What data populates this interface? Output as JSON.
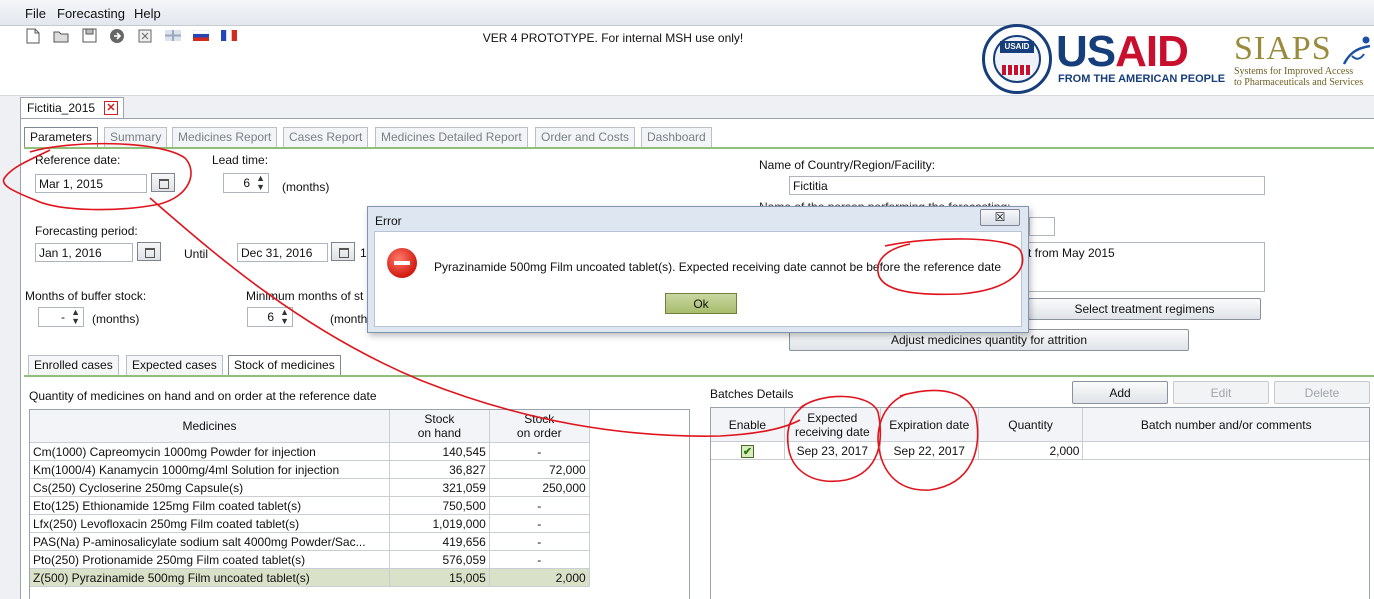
{
  "menu": [
    "File",
    "Forecasting",
    "Help"
  ],
  "toolbar": {
    "icons": [
      "new-document-icon",
      "open-folder-icon",
      "save-icon",
      "go-arrow-icon",
      "export-icon",
      "flag-uk-icon",
      "flag-russia-icon",
      "flag-france-icon"
    ],
    "notice": "VER 4 PROTOTYPE. For internal MSH use only!"
  },
  "logo": {
    "usaid_us": "US",
    "usaid_aid": "AID",
    "usaid_sub": "FROM THE AMERICAN PEOPLE",
    "seal_tag": "USAID",
    "siaps": "SIAPS",
    "siaps_sub1": "Systems for Improved Access",
    "siaps_sub2": "to Pharmaceuticals and Services"
  },
  "document_tab": {
    "label": "Fictitia_2015",
    "close": "✕"
  },
  "tabs": [
    "Parameters",
    "Summary",
    "Medicines Report",
    "Cases Report",
    "Medicines Detailed Report",
    "Order and Costs",
    "Dashboard"
  ],
  "params": {
    "reference_date_label": "Reference date:",
    "reference_date": "Mar 1, 2015",
    "lead_time_label": "Lead time:",
    "lead_time": "6",
    "months_unit": "(months)",
    "months_unit_cut": "(month",
    "forecasting_period_label": "Forecasting period:",
    "period_start": "Jan 1, 2016",
    "until_label": "Until",
    "period_end": "Dec 31, 2016",
    "period_end_suffix": "1",
    "buffer_label": "Months of buffer stock:",
    "buffer_value": "-",
    "min_months_label": "Minimum months of st",
    "min_months_value": "6",
    "country_label": "Name of Country/Region/Facility:",
    "country_value": "Fictitia",
    "person_label_partial": "Name of the person performing the forecasting:",
    "comment_fragment": "t from May 2015",
    "select_regimens_button": "Select treatment regimens",
    "adjust_button": "Adjust medicines quantity for attrition"
  },
  "subtabs": [
    "Enrolled cases",
    "Expected cases",
    "Stock of medicines"
  ],
  "stock": {
    "title": "Quantity of medicines on hand and on order at the reference date",
    "headers": [
      "Medicines",
      "Stock on hand",
      "Stock on order"
    ],
    "header_on_hand": [
      "Stock",
      "on hand"
    ],
    "header_on_order": [
      "Stock",
      "on order"
    ],
    "rows": [
      {
        "medicine": "Cm(1000)  Capreomycin  1000mg  Powder for injection",
        "on_hand": "140,545",
        "on_order": "-"
      },
      {
        "medicine": "Km(1000/4)  Kanamycin  1000mg/4ml  Solution for injection",
        "on_hand": "36,827",
        "on_order": "72,000"
      },
      {
        "medicine": "Cs(250)  Cycloserine  250mg  Capsule(s)",
        "on_hand": "321,059",
        "on_order": "250,000"
      },
      {
        "medicine": "Eto(125)  Ethionamide  125mg  Film coated tablet(s)",
        "on_hand": "750,500",
        "on_order": "-"
      },
      {
        "medicine": "Lfx(250)  Levofloxacin  250mg  Film coated tablet(s)",
        "on_hand": "1,019,000",
        "on_order": "-"
      },
      {
        "medicine": "PAS(Na)  P-aminosalicylate sodium salt  4000mg  Powder/Sac...",
        "on_hand": "419,656",
        "on_order": "-"
      },
      {
        "medicine": "Pto(250)  Protionamide   250mg  Film coated tablet(s)",
        "on_hand": "576,059",
        "on_order": "-"
      },
      {
        "medicine": "Z(500)  Pyrazinamide  500mg  Film uncoated tablet(s)",
        "on_hand": "15,005",
        "on_order": "2,000"
      }
    ]
  },
  "batches": {
    "title": "Batches Details",
    "buttons": [
      "Add",
      "Edit",
      "Delete"
    ],
    "headers": [
      "Enable",
      "Expected receiving date",
      "Expiration date",
      "Quantity",
      "Batch number and/or comments"
    ],
    "header_expected": [
      "Expected",
      "receiving date"
    ],
    "rows": [
      {
        "enabled": "✔",
        "expected": "Sep 23, 2017",
        "expiration": "Sep 22, 2017",
        "quantity": "2,000",
        "comments": ""
      }
    ]
  },
  "dialog": {
    "title": "Error",
    "close": "☒",
    "message": "Pyrazinamide  500mg  Film uncoated tablet(s). Expected receiving date cannot be before the reference date",
    "ok": "Ok"
  },
  "colors": {
    "accent_green": "#8fbf7a",
    "annotation_red": "#e0141c",
    "usaid_blue": "#163e7a",
    "usaid_red": "#c8102e"
  }
}
